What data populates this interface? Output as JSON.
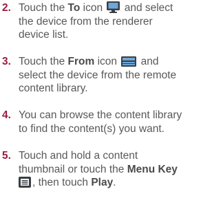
{
  "steps": [
    {
      "number": "2.",
      "lines": [
        {
          "pre": "Touch the ",
          "bold": "To",
          "mid": " icon ",
          "icon": "monitor-icon",
          "post": " and select"
        },
        {
          "text": "the device from the renderer"
        },
        {
          "text": "device list."
        }
      ]
    },
    {
      "number": "3.",
      "lines": [
        {
          "pre": "Touch the ",
          "bold": "From",
          "mid": " icon ",
          "icon": "media-server-icon",
          "post": " and"
        },
        {
          "text": "select the device from the remote"
        },
        {
          "text": "content library."
        }
      ]
    },
    {
      "number": "4.",
      "lines": [
        {
          "text": "You can browse the content library"
        },
        {
          "text": "to find the content(s) you want."
        }
      ]
    },
    {
      "number": "5.",
      "lines": [
        {
          "text": "Touch and hold a content"
        },
        {
          "pre": "thumbnail or touch the ",
          "bold": "Menu Key"
        },
        {
          "icon": "menu-key-icon",
          "post": ", then touch ",
          "bold": "Play",
          "end": "."
        }
      ]
    }
  ],
  "colors": {
    "number": "#9a1b3d",
    "text": "#58585a",
    "icon_dark": "#3a3f44",
    "icon_blue": "#6ea8d8"
  }
}
